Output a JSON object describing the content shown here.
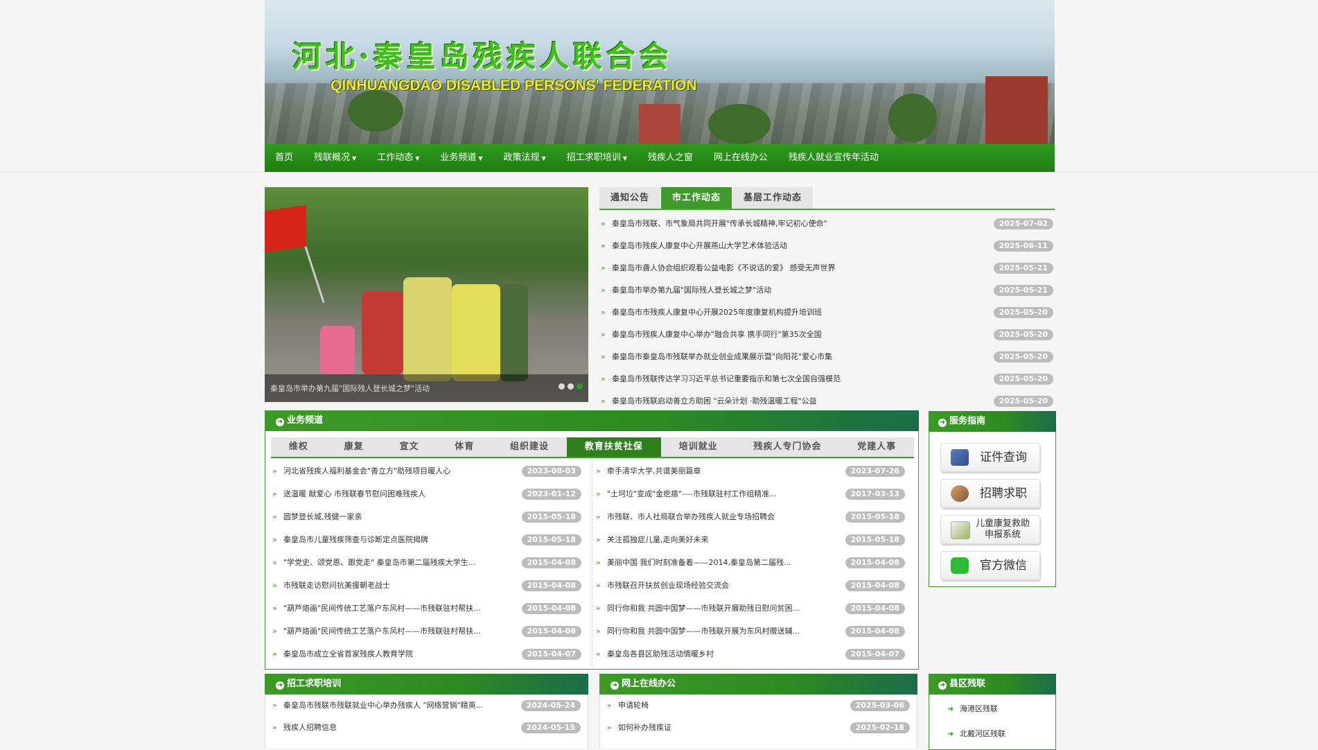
{
  "banner": {
    "title_cn": "河北·秦皇岛残疾人联合会",
    "title_en": "QINHUANGDAO DISABLED PERSONS' FEDERATION"
  },
  "nav": {
    "items": [
      {
        "label": "首页",
        "dropdown": false
      },
      {
        "label": "残联概况",
        "dropdown": true
      },
      {
        "label": "工作动态",
        "dropdown": true
      },
      {
        "label": "业务频道",
        "dropdown": true
      },
      {
        "label": "政策法规",
        "dropdown": true
      },
      {
        "label": "招工求职培训",
        "dropdown": true
      },
      {
        "label": "残疾人之窗",
        "dropdown": false
      },
      {
        "label": "网上在线办公",
        "dropdown": false
      },
      {
        "label": "残疾人就业宣传年活动",
        "dropdown": false
      }
    ]
  },
  "slider": {
    "caption": "秦皇岛市举办第九届\"国际残人登长城之梦\"活动"
  },
  "news": {
    "tabs": [
      "通知公告",
      "市工作动态",
      "基层工作动态"
    ],
    "active_tab": 1,
    "items": [
      {
        "title": "秦皇岛市残联、市气象局共同开展\"传承长城精神,牢记初心使命\"",
        "date": "2025-07-02"
      },
      {
        "title": "秦皇岛市残疾人康复中心开展燕山大学艺术体验活动",
        "date": "2025-06-11"
      },
      {
        "title": "秦皇岛市聋人协会组织观看公益电影《不说话的爱》 感受无声世界",
        "date": "2025-05-21"
      },
      {
        "title": "秦皇岛市举办第九届\"国际残人登长城之梦\"活动",
        "date": "2025-05-21"
      },
      {
        "title": "秦皇岛市市残疾人康复中心开展2025年度康复机构提升培训班",
        "date": "2025-05-20"
      },
      {
        "title": "秦皇岛市残疾人康复中心举办\"融合共享 携手同行\"第35次全国",
        "date": "2025-05-20"
      },
      {
        "title": "秦皇岛市秦皇岛市残联举办就业创业成果展示暨\"向阳花\"爱心市集",
        "date": "2025-05-20"
      },
      {
        "title": "秦皇岛市残联传达学习习近平总书记重要指示和第七次全国自强模范",
        "date": "2025-05-20"
      },
      {
        "title": "秦皇岛市残联启动善立方助困 \"云朵计划 ·助残温暖工程\"公益",
        "date": "2025-05-20"
      }
    ]
  },
  "business": {
    "heading": "业务频道",
    "tabs": [
      "维权",
      "康复",
      "宣文",
      "体育",
      "组织建设",
      "教育扶贫社保",
      "培训就业",
      "残疾人专门协会",
      "党建人事"
    ],
    "active_tab": 5,
    "left": [
      {
        "title": "河北省残疾人福利基金会\"善立方\"助残项目暖人心",
        "date": "2023-08-03"
      },
      {
        "title": "送温暖 献爱心 市残联春节慰问困难残疾人",
        "date": "2023-01-12"
      },
      {
        "title": "圆梦登长城,残健一家亲",
        "date": "2015-05-18"
      },
      {
        "title": "秦皇岛市儿童残疾筛查与诊断定点医院揭牌",
        "date": "2015-05-18"
      },
      {
        "title": "\"学党史、颂党恩、跟党走\" 秦皇岛市第二届残疾大学生...",
        "date": "2015-04-08"
      },
      {
        "title": "市残联走访慰问抗美援朝老战士",
        "date": "2015-04-08"
      },
      {
        "title": "\"葫芦烙画\"民间传统工艺落户东风村——市残联驻村帮扶...",
        "date": "2015-04-08"
      },
      {
        "title": "\"葫芦烙画\"民间传统工艺落户东风村——市残联驻村帮扶...",
        "date": "2015-04-08"
      },
      {
        "title": "秦皇岛市成立全省首家残疾人教育学院",
        "date": "2015-04-07"
      }
    ],
    "right": [
      {
        "title": "牵手清华大学,共谱美丽篇章",
        "date": "2023-07-26"
      },
      {
        "title": "\"土坷垃\"变成\"金疙瘩\"----市残联驻村工作组精准...",
        "date": "2017-03-13"
      },
      {
        "title": "市残联、市人社局联合举办残疾人就业专场招聘会",
        "date": "2015-05-18"
      },
      {
        "title": "关注孤独症儿童,走向美好未来",
        "date": "2015-05-18"
      },
      {
        "title": "美丽中国 我们时刻准备着——2014,秦皇岛第二届残...",
        "date": "2015-04-08"
      },
      {
        "title": "市残联召开扶贫创业现场经验交流会",
        "date": "2015-04-08"
      },
      {
        "title": "同行你和我 共圆中国梦——市残联开展助残日慰问贫困...",
        "date": "2015-04-08"
      },
      {
        "title": "同行你和我 共圆中国梦——市残联开展为东风村赠送辅...",
        "date": "2015-04-08"
      },
      {
        "title": "秦皇岛各县区助残活动情暖乡村",
        "date": "2015-04-07"
      }
    ]
  },
  "service": {
    "heading": "服务指南",
    "buttons": [
      {
        "label": "证件查询",
        "icon": "id-card-icon"
      },
      {
        "label": "招聘求职",
        "icon": "people-icon"
      },
      {
        "label": "儿童康复救助申报系统",
        "line1": "儿童康复救助",
        "line2": "申报系统",
        "icon": "form-icon"
      },
      {
        "label": "官方微信",
        "icon": "wechat-icon"
      }
    ]
  },
  "jobs": {
    "heading": "招工求职培训",
    "items": [
      {
        "title": "秦皇岛市残联市残联就业中心举办残疾人 \"网络营销\"精英...",
        "date": "2024-05-24"
      },
      {
        "title": "残疾人招聘信息",
        "date": "2024-05-15"
      }
    ]
  },
  "office": {
    "heading": "网上在线办公",
    "items": [
      {
        "title": "申请轮椅",
        "date": "2025-03-06"
      },
      {
        "title": "如何补办残疾证",
        "date": "2025-02-18"
      }
    ]
  },
  "county": {
    "heading": "县区残联",
    "items": [
      "海港区残联",
      "北戴河区残联"
    ]
  },
  "colors": {
    "brand_green": "#2f9b1e",
    "tab_active": "#3f9a2b",
    "date_badge": "#bcbcbc"
  }
}
